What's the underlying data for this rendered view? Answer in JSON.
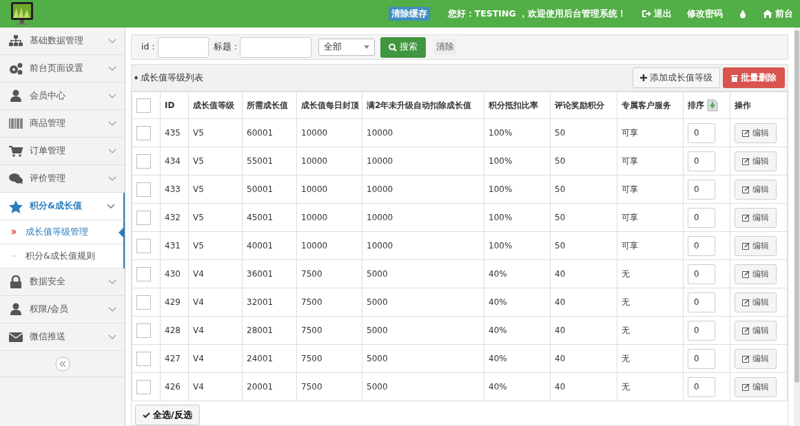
{
  "header": {
    "clear_cache": "清除缓存",
    "greeting": "您好：TESTING ，欢迎使用后台管理系统！",
    "links": [
      {
        "kind": "link",
        "text": "退出"
      },
      {
        "kind": "link",
        "text": "修改密码"
      },
      {
        "kind": "icon"
      },
      {
        "kind": "link",
        "text": "前台"
      }
    ]
  },
  "sidebar": {
    "items": [
      {
        "label": "基础数据管理",
        "expanded": false,
        "selected": false
      },
      {
        "label": "前台页面设置",
        "expanded": false,
        "selected": false
      },
      {
        "label": "会员中心",
        "expanded": false,
        "selected": false
      },
      {
        "label": "商品管理",
        "expanded": false,
        "selected": false
      },
      {
        "label": "订单管理",
        "expanded": false,
        "selected": false
      },
      {
        "label": "评价管理",
        "expanded": false,
        "selected": false
      },
      {
        "label": "积分&成长值",
        "expanded": true,
        "selected": true,
        "children": [
          {
            "label": "成长值等级管理",
            "selected": true
          },
          {
            "label": "积分&成长值规则",
            "selected": false
          }
        ]
      },
      {
        "label": "数据安全",
        "expanded": false,
        "selected": false
      },
      {
        "label": "权限/会员",
        "expanded": false,
        "selected": false
      },
      {
        "label": "微信推送",
        "expanded": false,
        "selected": false
      }
    ]
  },
  "filter": {
    "id_label": "id :",
    "title_label": "标题 :",
    "select_value": "全部",
    "search_button": "搜索",
    "clear_button": "清除"
  },
  "list": {
    "title": "成长值等级列表",
    "add_button": "添加成长值等级",
    "delete_button": "批量删除",
    "select_all_button": "全选/反选"
  },
  "table": {
    "all_checked": false,
    "columns": [
      "ID",
      "成长值等级",
      "所需成长值",
      "成长值每日封顶",
      "满2年未升级自动扣除成长值",
      "积分抵扣比率",
      "评论奖励积分",
      "专属客户服务",
      "排序",
      "操作"
    ],
    "rows": [
      {
        "checked": false,
        "cells": [
          "435",
          "V5",
          "60001",
          "10000",
          "10000",
          "100%",
          "50",
          "可享"
        ],
        "sort": "0",
        "action": "编辑"
      },
      {
        "checked": false,
        "cells": [
          "434",
          "V5",
          "55001",
          "10000",
          "10000",
          "100%",
          "50",
          "可享"
        ],
        "sort": "0",
        "action": "编辑"
      },
      {
        "checked": false,
        "cells": [
          "433",
          "V5",
          "50001",
          "10000",
          "10000",
          "100%",
          "50",
          "可享"
        ],
        "sort": "0",
        "action": "编辑"
      },
      {
        "checked": false,
        "cells": [
          "432",
          "V5",
          "45001",
          "10000",
          "10000",
          "100%",
          "50",
          "可享"
        ],
        "sort": "0",
        "action": "编辑"
      },
      {
        "checked": false,
        "cells": [
          "431",
          "V5",
          "40001",
          "10000",
          "10000",
          "100%",
          "50",
          "可享"
        ],
        "sort": "0",
        "action": "编辑"
      },
      {
        "checked": false,
        "cells": [
          "430",
          "V4",
          "36001",
          "7500",
          "5000",
          "40%",
          "40",
          "无"
        ],
        "sort": "0",
        "action": "编辑"
      },
      {
        "checked": false,
        "cells": [
          "429",
          "V4",
          "32001",
          "7500",
          "5000",
          "40%",
          "40",
          "无"
        ],
        "sort": "0",
        "action": "编辑"
      },
      {
        "checked": false,
        "cells": [
          "428",
          "V4",
          "28001",
          "7500",
          "5000",
          "40%",
          "40",
          "无"
        ],
        "sort": "0",
        "action": "编辑"
      },
      {
        "checked": false,
        "cells": [
          "427",
          "V4",
          "24001",
          "7500",
          "5000",
          "40%",
          "40",
          "无"
        ],
        "sort": "0",
        "action": "编辑"
      },
      {
        "checked": false,
        "cells": [
          "426",
          "V4",
          "20001",
          "7500",
          "5000",
          "40%",
          "40",
          "无"
        ],
        "sort": "0",
        "action": "编辑"
      }
    ]
  }
}
